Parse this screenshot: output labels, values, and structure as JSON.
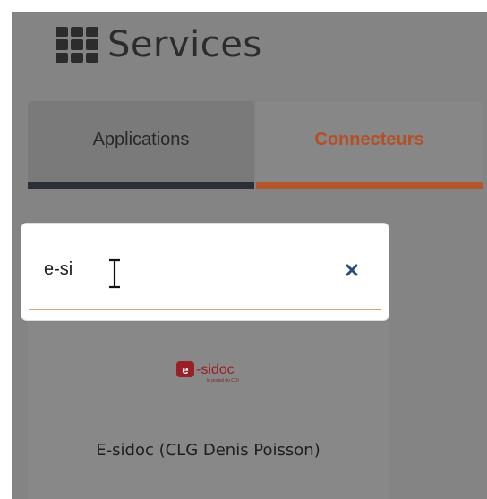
{
  "page": {
    "title": "Services",
    "title_icon": "grid-icon"
  },
  "tabs": [
    {
      "label": "Applications",
      "active": false
    },
    {
      "label": "Connecteurs",
      "active": true
    }
  ],
  "search": {
    "value": "e-si",
    "clear_icon": "close-icon"
  },
  "results": [
    {
      "logo_text": "e-sidoc",
      "logo_tagline": "le portail du CDI",
      "label": "E-sidoc (CLG Denis Poisson)"
    }
  ],
  "colors": {
    "backdrop": "#848484",
    "active_tab_text": "#b44e25",
    "active_tab_underline": "#b6562e",
    "inactive_tab_underline": "#2b3036",
    "clear_icon": "#2b4a80"
  }
}
